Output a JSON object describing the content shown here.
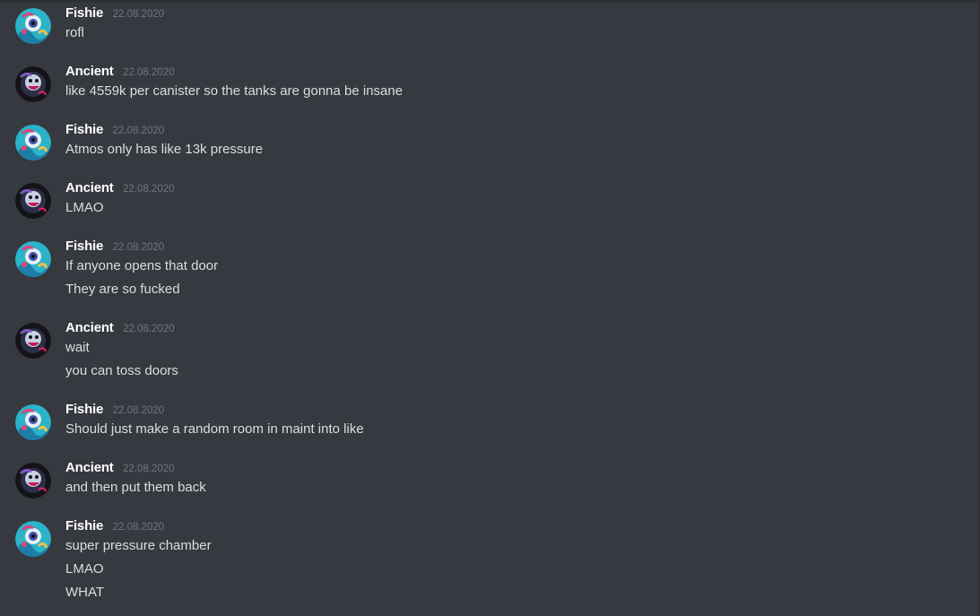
{
  "colors": {
    "background": "#36393f",
    "username": "#ffffff",
    "timestamp": "#72767d",
    "message_text": "#dcddde"
  },
  "messages": [
    {
      "author": "Fishie",
      "avatar": "fishie-avatar-icon",
      "timestamp": "22.08.2020",
      "lines": [
        "rofl"
      ]
    },
    {
      "author": "Ancient",
      "avatar": "ancient-avatar-icon",
      "timestamp": "22.08.2020",
      "lines": [
        "like 4559k per canister so the tanks are gonna be insane"
      ]
    },
    {
      "author": "Fishie",
      "avatar": "fishie-avatar-icon",
      "timestamp": "22.08.2020",
      "lines": [
        "Atmos only has like 13k pressure"
      ]
    },
    {
      "author": "Ancient",
      "avatar": "ancient-avatar-icon",
      "timestamp": "22.08.2020",
      "lines": [
        "LMAO"
      ]
    },
    {
      "author": "Fishie",
      "avatar": "fishie-avatar-icon",
      "timestamp": "22.08.2020",
      "lines": [
        "If anyone opens that door",
        "They are so fucked"
      ]
    },
    {
      "author": "Ancient",
      "avatar": "ancient-avatar-icon",
      "timestamp": "22.08.2020",
      "lines": [
        "wait",
        "you can toss doors"
      ]
    },
    {
      "author": "Fishie",
      "avatar": "fishie-avatar-icon",
      "timestamp": "22.08.2020",
      "lines": [
        "Should just make a random room in maint into like"
      ]
    },
    {
      "author": "Ancient",
      "avatar": "ancient-avatar-icon",
      "timestamp": "22.08.2020",
      "lines": [
        "and then put them back"
      ]
    },
    {
      "author": "Fishie",
      "avatar": "fishie-avatar-icon",
      "timestamp": "22.08.2020",
      "lines": [
        "super pressure chamber",
        "LMAO",
        "WHAT"
      ]
    }
  ]
}
